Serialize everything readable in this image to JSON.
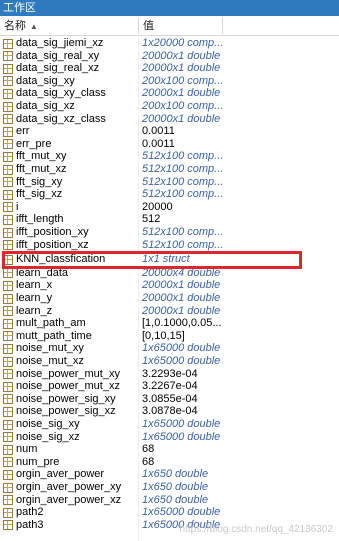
{
  "panel": {
    "title": "工作区",
    "col_name": "名称",
    "sort_indicator": "▲",
    "col_value": "值"
  },
  "rows": [
    {
      "name": "data_sig_jiemi_xz",
      "value": "1x20000 comp...",
      "kind": "desc"
    },
    {
      "name": "data_sig_real_xy",
      "value": "20000x1 double",
      "kind": "desc"
    },
    {
      "name": "data_sig_real_xz",
      "value": "20000x1 double",
      "kind": "desc"
    },
    {
      "name": "data_sig_xy",
      "value": "200x100 comp...",
      "kind": "desc"
    },
    {
      "name": "data_sig_xy_class",
      "value": "20000x1 double",
      "kind": "desc"
    },
    {
      "name": "data_sig_xz",
      "value": "200x100 comp...",
      "kind": "desc"
    },
    {
      "name": "data_sig_xz_class",
      "value": "20000x1 double",
      "kind": "desc"
    },
    {
      "name": "err",
      "value": "0.0011",
      "kind": "plain"
    },
    {
      "name": "err_pre",
      "value": "0.0011",
      "kind": "plain"
    },
    {
      "name": "fft_mut_xy",
      "value": "512x100 comp...",
      "kind": "desc"
    },
    {
      "name": "fft_mut_xz",
      "value": "512x100 comp...",
      "kind": "desc"
    },
    {
      "name": "fft_sig_xy",
      "value": "512x100 comp...",
      "kind": "desc"
    },
    {
      "name": "fft_sig_xz",
      "value": "512x100 comp...",
      "kind": "desc"
    },
    {
      "name": "i",
      "value": "20000",
      "kind": "plain"
    },
    {
      "name": "ifft_length",
      "value": "512",
      "kind": "plain"
    },
    {
      "name": "ifft_position_xy",
      "value": "512x100 comp...",
      "kind": "desc"
    },
    {
      "name": "ifft_position_xz",
      "value": "512x100 comp...",
      "kind": "desc"
    },
    {
      "name": "KNN_classfication",
      "value": "1x1 struct",
      "kind": "desc",
      "highlighted": true
    },
    {
      "name": "learn_data",
      "value": "20000x4 double",
      "kind": "desc"
    },
    {
      "name": "learn_x",
      "value": "20000x1 double",
      "kind": "desc"
    },
    {
      "name": "learn_y",
      "value": "20000x1 double",
      "kind": "desc"
    },
    {
      "name": "learn_z",
      "value": "20000x1 double",
      "kind": "desc"
    },
    {
      "name": "mult_path_am",
      "value": "[1,0.1000,0.05...",
      "kind": "plain"
    },
    {
      "name": "mutt_path_time",
      "value": "[0,10,15]",
      "kind": "plain"
    },
    {
      "name": "noise_mut_xy",
      "value": "1x65000 double",
      "kind": "desc"
    },
    {
      "name": "noise_mut_xz",
      "value": "1x65000 double",
      "kind": "desc"
    },
    {
      "name": "noise_power_mut_xy",
      "value": "3.2293e-04",
      "kind": "plain"
    },
    {
      "name": "noise_power_mut_xz",
      "value": "3.2267e-04",
      "kind": "plain"
    },
    {
      "name": "noise_power_sig_xy",
      "value": "3.0855e-04",
      "kind": "plain"
    },
    {
      "name": "noise_power_sig_xz",
      "value": "3.0878e-04",
      "kind": "plain"
    },
    {
      "name": "noise_sig_xy",
      "value": "1x65000 double",
      "kind": "desc"
    },
    {
      "name": "noise_sig_xz",
      "value": "1x65000 double",
      "kind": "desc"
    },
    {
      "name": "num",
      "value": "68",
      "kind": "plain"
    },
    {
      "name": "num_pre",
      "value": "68",
      "kind": "plain"
    },
    {
      "name": "orgin_aver_power",
      "value": "1x650 double",
      "kind": "desc"
    },
    {
      "name": "orgin_aver_power_xy",
      "value": "1x650 double",
      "kind": "desc"
    },
    {
      "name": "orgin_aver_power_xz",
      "value": "1x650 double",
      "kind": "desc"
    },
    {
      "name": "path2",
      "value": "1x65000 double",
      "kind": "desc"
    },
    {
      "name": "path3",
      "value": "1x65000 double",
      "kind": "desc"
    }
  ],
  "watermark": "https://blog.csdn.net/qq_42136302"
}
